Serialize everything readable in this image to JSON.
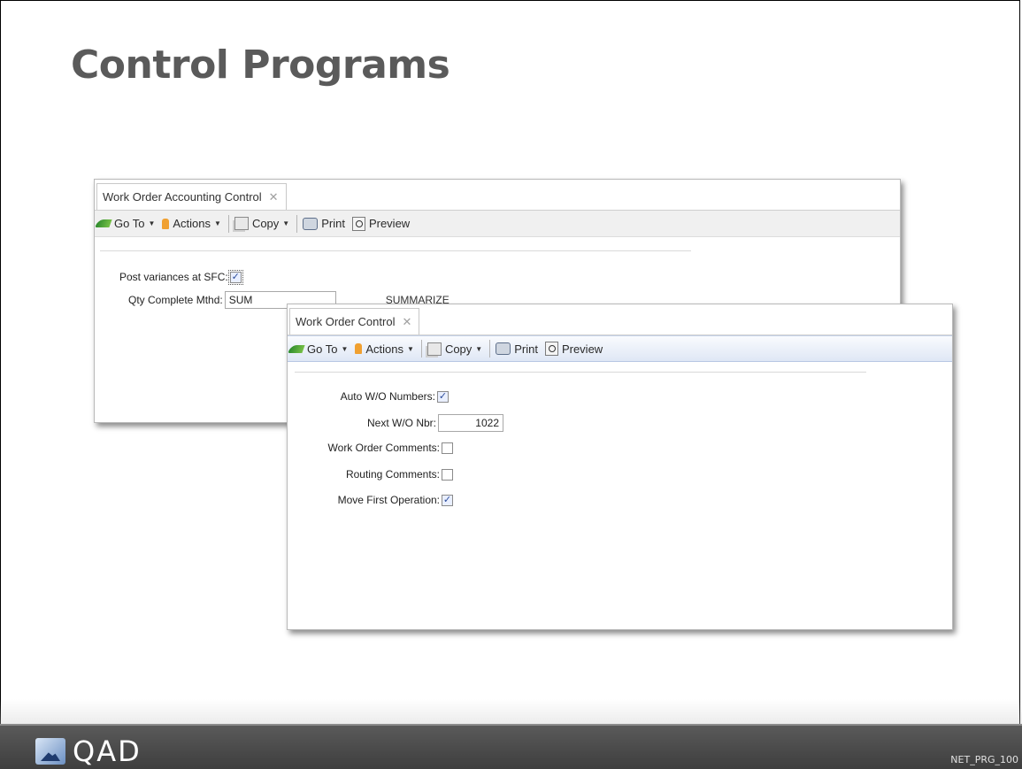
{
  "slide": {
    "title": "Control Programs",
    "code": "NET_PRG_100"
  },
  "toolbar": {
    "goto": "Go To",
    "actions": "Actions",
    "copy": "Copy",
    "print": "Print",
    "preview": "Preview"
  },
  "back_window": {
    "tab_title": "Work Order Accounting Control",
    "fields": {
      "post_variances_label": "Post variances at SFC:",
      "post_variances_checked": true,
      "qty_complete_label": "Qty Complete Mthd:",
      "qty_complete_value": "SUM",
      "qty_complete_desc": "SUMMARIZE"
    }
  },
  "front_window": {
    "tab_title": "Work Order Control",
    "fields": [
      {
        "label": "Auto W/O Numbers:",
        "type": "checkbox",
        "checked": true
      },
      {
        "label": "Next W/O Nbr:",
        "type": "text",
        "value": "1022"
      },
      {
        "label": "Work Order Comments:",
        "type": "checkbox",
        "checked": false
      },
      {
        "label": "Routing Comments:",
        "type": "checkbox",
        "checked": false
      },
      {
        "label": "Move First Operation:",
        "type": "checkbox",
        "checked": true
      }
    ]
  },
  "footer": {
    "logo_text": "QAD"
  }
}
